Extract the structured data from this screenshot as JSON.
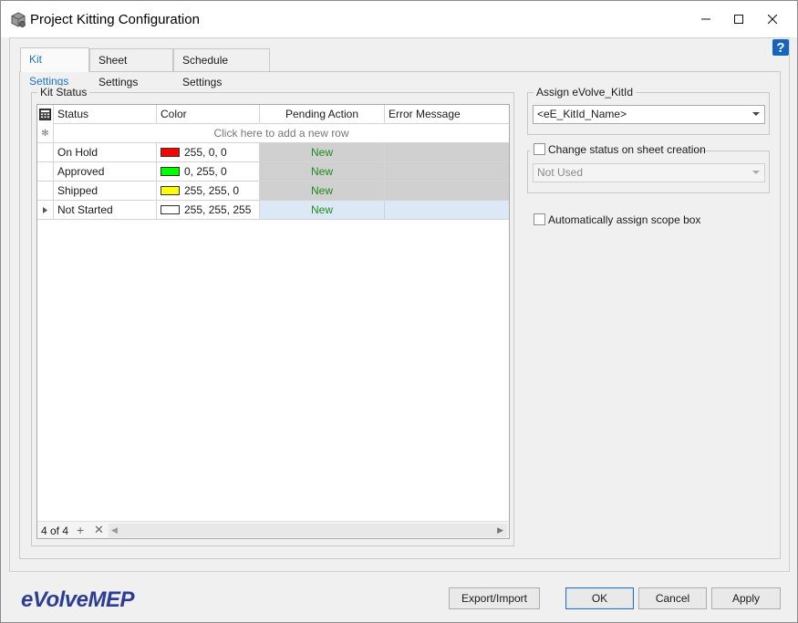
{
  "window": {
    "title": "Project Kitting Configuration"
  },
  "tabs": [
    {
      "label": "Kit Settings",
      "active": true
    },
    {
      "label": "Sheet Settings",
      "active": false
    },
    {
      "label": "Schedule Settings",
      "active": false
    }
  ],
  "help": {
    "label": "?"
  },
  "kit_status": {
    "group_title": "Kit Status",
    "columns": [
      "Status",
      "Color",
      "Pending Action",
      "Error Message"
    ],
    "new_row_prompt": "Click here to add a new row",
    "rows": [
      {
        "status": "On Hold",
        "color_hex": "#ff0000",
        "color_text": "255, 0, 0",
        "pending": "New",
        "error": ""
      },
      {
        "status": "Approved",
        "color_hex": "#00ff00",
        "color_text": "0, 255, 0",
        "pending": "New",
        "error": ""
      },
      {
        "status": "Shipped",
        "color_hex": "#ffff00",
        "color_text": "255, 255, 0",
        "pending": "New",
        "error": ""
      },
      {
        "status": "Not Started",
        "color_hex": "#ffffff",
        "color_text": "255, 255, 255",
        "pending": "New",
        "error": ""
      }
    ],
    "record_count": "4 of 4"
  },
  "assign_kitid": {
    "group_title": "Assign eVolve_KitId",
    "value": "<eE_KitId_Name>"
  },
  "change_status": {
    "label": "Change status on sheet creation",
    "checked": false,
    "value": "Not Used"
  },
  "scope_box": {
    "label": "Automatically assign scope box",
    "checked": false
  },
  "buttons": {
    "export_import": "Export/Import",
    "ok": "OK",
    "cancel": "Cancel",
    "apply": "Apply"
  },
  "brand": {
    "logo_text": "eVolveMEP",
    "color": "#2d3d96"
  }
}
